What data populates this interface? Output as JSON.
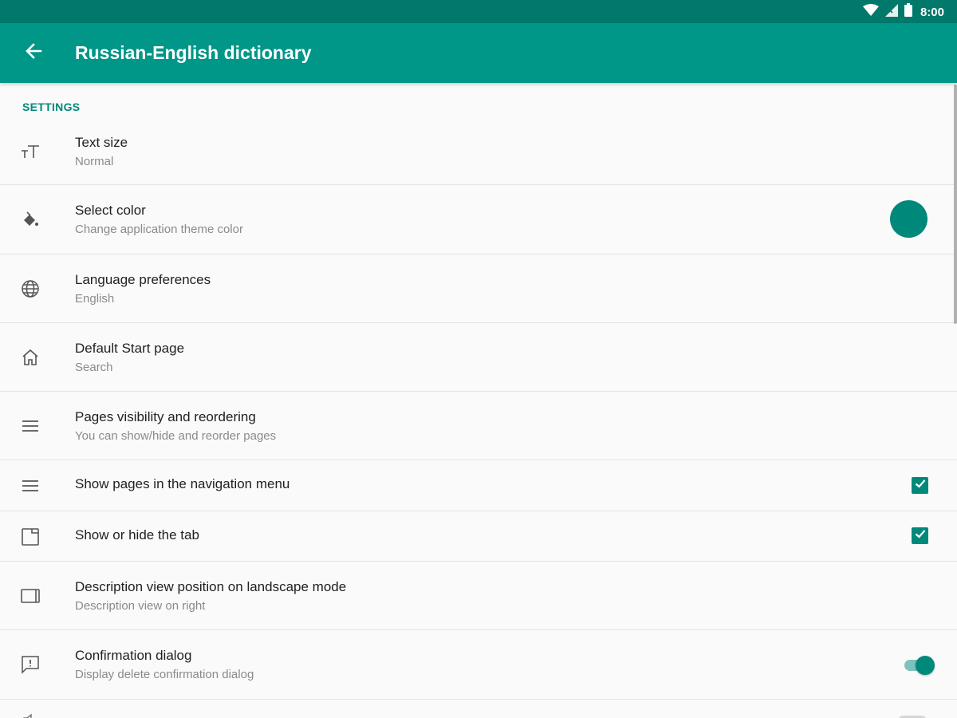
{
  "colors": {
    "primary": "#009688",
    "primary_dark": "#00796b",
    "accent": "#00897b",
    "theme_swatch": "#00897b"
  },
  "status_bar": {
    "time": "8:00",
    "icons": [
      "wifi-icon",
      "signal-icon",
      "battery-icon"
    ]
  },
  "app_bar": {
    "back_icon": "arrow-back-icon",
    "title": "Russian-English dictionary"
  },
  "settings": {
    "section_header": "SETTINGS",
    "items": [
      {
        "icon": "text-size-icon",
        "title": "Text size",
        "summary": "Normal",
        "control": "none"
      },
      {
        "icon": "paint-bucket-icon",
        "title": "Select color",
        "summary": "Change application theme color",
        "control": "color-swatch"
      },
      {
        "icon": "globe-icon",
        "title": "Language preferences",
        "summary": "English",
        "control": "none"
      },
      {
        "icon": "home-icon",
        "title": "Default Start page",
        "summary": "Search",
        "control": "none"
      },
      {
        "icon": "menu-icon",
        "title": "Pages visibility and reordering",
        "summary": "You can show/hide and reorder pages",
        "control": "none"
      },
      {
        "icon": "menu-icon",
        "title": "Show pages in the navigation menu",
        "summary": "",
        "control": "checkbox",
        "checked": true
      },
      {
        "icon": "tab-icon",
        "title": "Show or hide the tab",
        "summary": "",
        "control": "checkbox",
        "checked": true
      },
      {
        "icon": "tablet-landscape-icon",
        "title": "Description view position on landscape mode",
        "summary": "Description view on right",
        "control": "none"
      },
      {
        "icon": "feedback-icon",
        "title": "Confirmation dialog",
        "summary": "Display delete confirmation dialog",
        "control": "switch",
        "on": true
      }
    ]
  }
}
